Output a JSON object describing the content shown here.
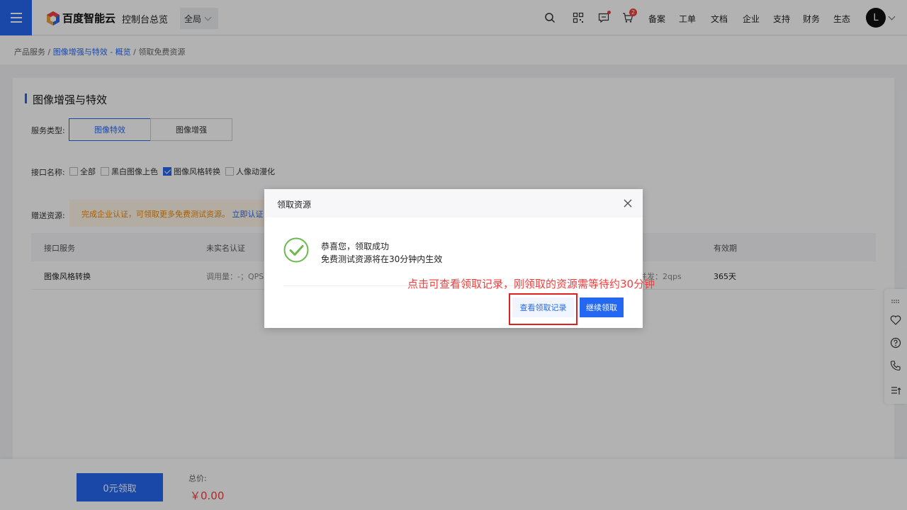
{
  "topbar": {
    "logo_text": "百度智能云",
    "console_title": "控制台总览",
    "region": "全局",
    "cart_badge": "2",
    "nav": [
      "备案",
      "工单",
      "文档",
      "企业",
      "支持",
      "财务",
      "生态"
    ],
    "avatar_initial": "L"
  },
  "breadcrumb": {
    "item1": "产品服务 /",
    "item2": "图像增强与特效 - 概览",
    "sep": " /",
    "item3": "领取免费资源"
  },
  "card": {
    "title": "图像增强与特效",
    "service_type_label": "服务类型:",
    "service_types": [
      "图像特效",
      "图像增强"
    ],
    "api_label": "接口名称:",
    "api_options": [
      {
        "label": "全部",
        "checked": false
      },
      {
        "label": "黑白图像上色",
        "checked": false
      },
      {
        "label": "图像风格转换",
        "checked": true
      },
      {
        "label": "人像动漫化",
        "checked": false
      }
    ],
    "gift_label": "赠送资源:",
    "gift_notice": "完成企业认证，可领取更多免费测试资源。",
    "gift_link": "立即认证",
    "table": {
      "headers": [
        "接口服务",
        "未实名认证",
        "有效期"
      ],
      "row": {
        "service": "图像风格转换",
        "unverified": "调用量：-；QPS",
        "partial": "并发：2qps",
        "validity": "365天"
      }
    }
  },
  "bottombar": {
    "claim_label": "0元领取",
    "total_label": "总价:",
    "total_price": "￥0.00"
  },
  "dialog": {
    "title": "领取资源",
    "success_title": "恭喜您，领取成功",
    "success_desc": "免费测试资源将在30分钟内生效",
    "view_record_label": "查看领取记录",
    "continue_label": "继续领取"
  },
  "annotation": "点击可查看领取记录，刚领取的资源需等待约30分钟",
  "colors": {
    "primary": "#2468f2",
    "danger": "#f33e3e",
    "warning": "#f38900",
    "success": "#6bb84f"
  }
}
